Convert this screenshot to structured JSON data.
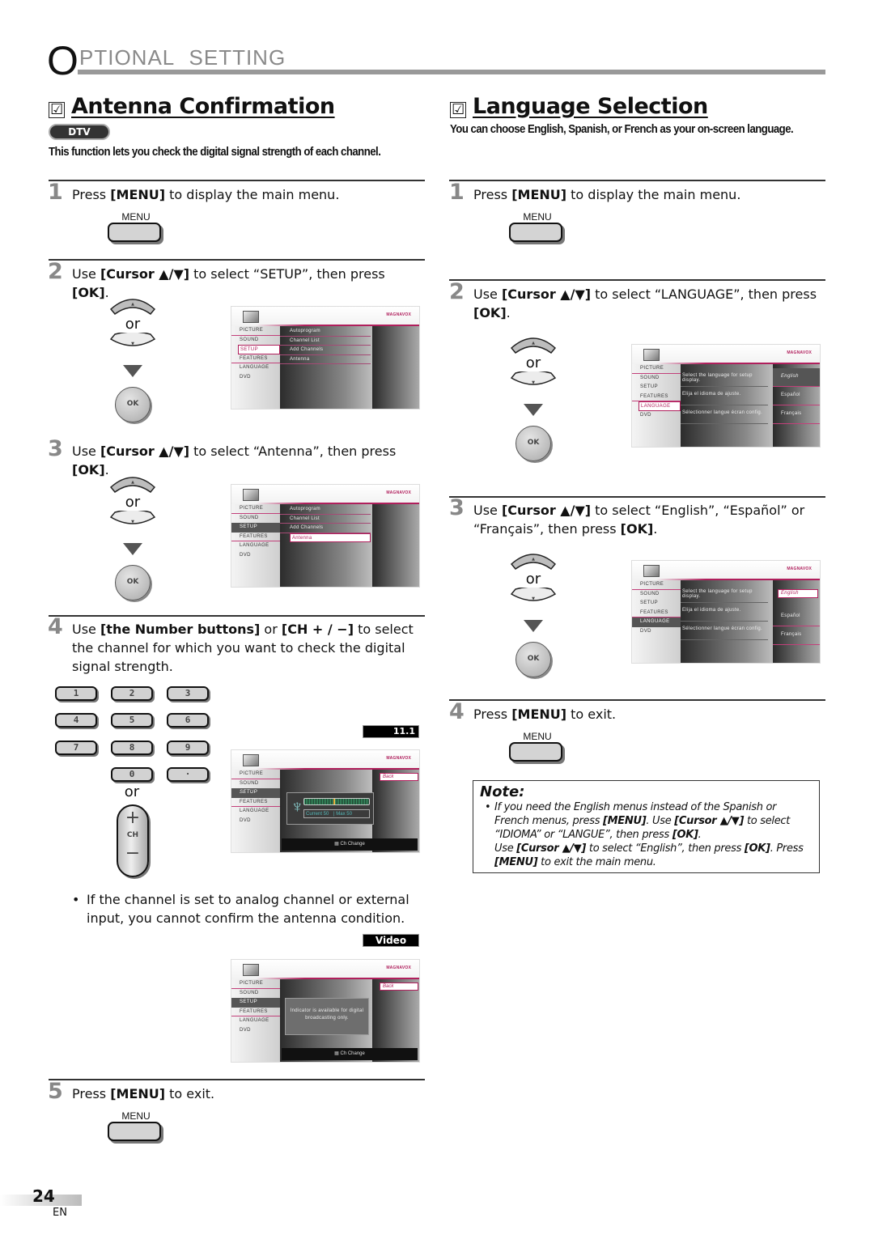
{
  "header": {
    "initial": "O",
    "rest": "PTIONAL SETTING"
  },
  "antenna": {
    "title": "Antenna Confirmation",
    "checkbox_glyph": "☑",
    "badge": "DTV",
    "intro": "This function lets you check the digital signal strength of each channel.",
    "steps": [
      {
        "num": "1",
        "html_parts": [
          "Press ",
          "[MENU]",
          " to display the main menu."
        ]
      },
      {
        "num": "2",
        "html_parts": [
          "Use ",
          "[Cursor ▲/▼]",
          " to select “SETUP”, then press ",
          "[OK]",
          "."
        ]
      },
      {
        "num": "3",
        "html_parts": [
          "Use ",
          "[Cursor ▲/▼]",
          " to select “Antenna”, then press ",
          "[OK]",
          "."
        ]
      },
      {
        "num": "4",
        "html_parts": [
          "Use ",
          "[the Number buttons]",
          " or ",
          "[CH + / −]",
          " to select the channel for which you want to check the digital signal strength."
        ]
      },
      {
        "num": "5",
        "html_parts": [
          "Press ",
          "[MENU]",
          " to exit."
        ]
      }
    ],
    "bullet": "If the channel is set to analog channel or external input, you cannot confirm the antenna condition."
  },
  "language": {
    "title": "Language Selection",
    "checkbox_glyph": "☑",
    "intro": "You can choose English, Spanish, or French as your on-screen language.",
    "steps": [
      {
        "num": "1",
        "html_parts": [
          "Press ",
          "[MENU]",
          " to display the main menu."
        ]
      },
      {
        "num": "2",
        "html_parts": [
          "Use ",
          "[Cursor ▲/▼]",
          " to select “LANGUAGE”, then press ",
          "[OK]",
          "."
        ]
      },
      {
        "num": "3",
        "html_parts": [
          "Use ",
          "[Cursor ▲/▼]",
          " to select “English”, “Español” or “Français”, then press ",
          "[OK]",
          "."
        ]
      },
      {
        "num": "4",
        "html_parts": [
          "Press ",
          "[MENU]",
          " to exit."
        ]
      }
    ],
    "note": {
      "title": "Note:",
      "parts": [
        "If you need the English menus instead of the Spanish or French menus, press ",
        "[MENU]",
        ". Use ",
        "[Cursor ▲/▼]",
        " to select “IDIOMA” or “LANGUE”, then press ",
        "[OK]",
        ".",
        "Use ",
        "[Cursor ▲/▼]",
        " to select “English”, then press ",
        "[OK]",
        ". Press ",
        "[MENU]",
        " to exit the main menu."
      ]
    }
  },
  "remote": {
    "menu_label": "MENU",
    "or_label": "or",
    "ok_label": "OK",
    "up_glyph": "▲",
    "down_glyph": "▼",
    "number_buttons": [
      "1",
      "2",
      "3",
      "4",
      "5",
      "6",
      "7",
      "8",
      "9",
      "0",
      "·"
    ],
    "ch_plus": "+",
    "ch_label": "CH",
    "ch_minus": "−"
  },
  "tv": {
    "brand": "MAGNAVOX",
    "menu_items": [
      "PICTURE",
      "SOUND",
      "SETUP",
      "FEATURES",
      "LANGUAGE",
      "DVD"
    ],
    "setup_items": [
      "Autoprogram",
      "Channel List",
      "Add Channels",
      "Antenna"
    ],
    "back_label": "Back",
    "ch_change_label": "Ch Change",
    "channel_display": "11.1",
    "input_display": "Video",
    "signal": {
      "current_label": "Current",
      "current": 50,
      "max_label": "Max",
      "max": 50
    },
    "digital_only_msg": "Indicator is available for digital broadcasting only.",
    "lang_descriptions": [
      "Select the language for setup display.",
      "Elija el idioma de ajuste.",
      "Sélectionner langue écran config."
    ],
    "lang_options": [
      "English",
      "Español",
      "Français"
    ]
  },
  "footer": {
    "page": "24",
    "lang": "EN"
  }
}
